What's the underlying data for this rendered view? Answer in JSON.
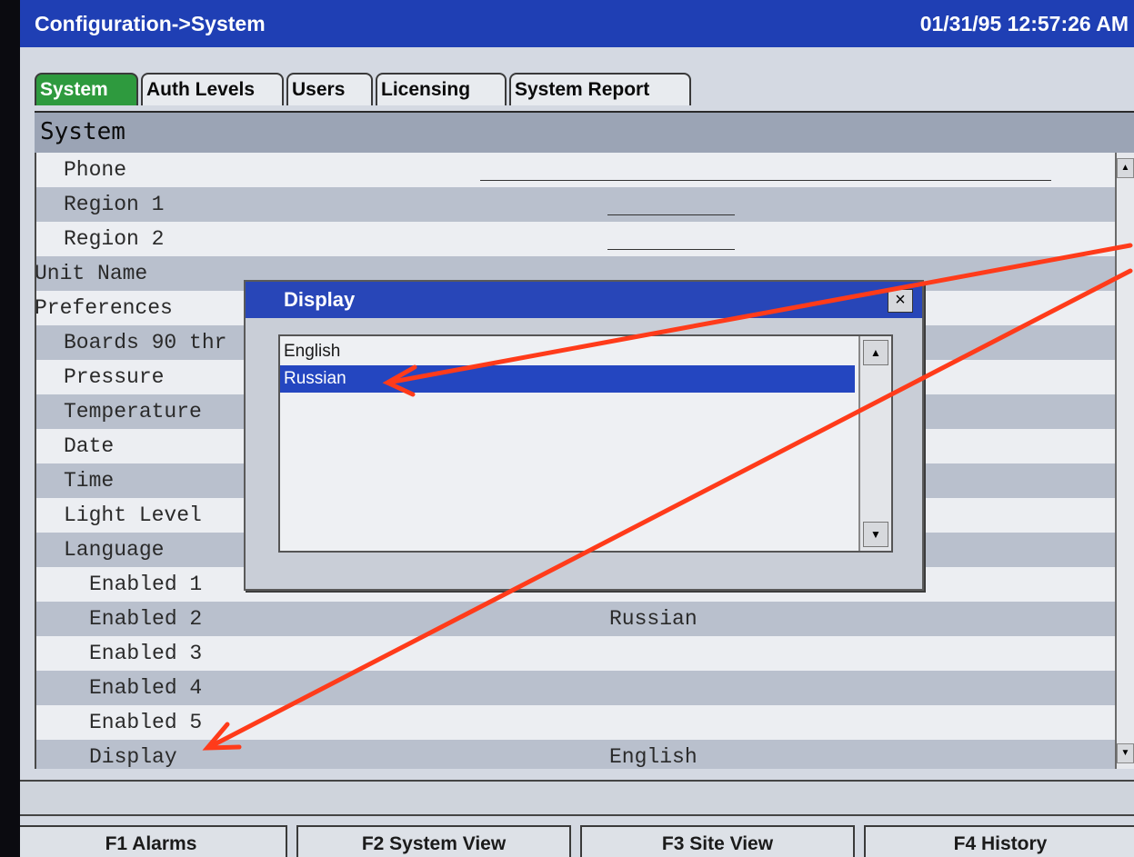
{
  "header": {
    "title": "Configuration->System",
    "datetime": "01/31/95 12:57:26 AM"
  },
  "tabs": [
    {
      "label": "System",
      "active": true
    },
    {
      "label": "Auth Levels",
      "active": false
    },
    {
      "label": "Users",
      "active": false
    },
    {
      "label": "Licensing",
      "active": false
    },
    {
      "label": "System Report",
      "active": false
    }
  ],
  "section": {
    "title": "System"
  },
  "rows": [
    {
      "label": "Phone",
      "value": ""
    },
    {
      "label": "Region 1",
      "value": ""
    },
    {
      "label": "Region 2",
      "value": ""
    },
    {
      "label": "Unit Name",
      "value": ""
    },
    {
      "label": "Preferences",
      "value": ""
    },
    {
      "label": "Boards 90 thr",
      "value": ""
    },
    {
      "label": "Pressure",
      "value": ""
    },
    {
      "label": "Temperature",
      "value": ""
    },
    {
      "label": "Date",
      "value": ""
    },
    {
      "label": "Time",
      "value": ""
    },
    {
      "label": "Light Level",
      "value": ""
    },
    {
      "label": "Language",
      "value": ""
    },
    {
      "label": "Enabled 1",
      "value": ""
    },
    {
      "label": "Enabled 2",
      "value": "Russian"
    },
    {
      "label": "Enabled 3",
      "value": ""
    },
    {
      "label": "Enabled 4",
      "value": ""
    },
    {
      "label": "Enabled 5",
      "value": ""
    },
    {
      "label": "Display",
      "value": "English"
    }
  ],
  "dialog": {
    "title": "Display",
    "close_label": "×",
    "options": [
      {
        "label": "English",
        "selected": false
      },
      {
        "label": "Russian",
        "selected": true
      }
    ],
    "scroll_up": "▲",
    "scroll_down": "▼"
  },
  "function_keys": [
    {
      "label": "F1 Alarms"
    },
    {
      "label": "F2 System View"
    },
    {
      "label": "F3 Site View"
    },
    {
      "label": "F4 History"
    }
  ],
  "colors": {
    "title_bar": "#1f3fb4",
    "active_tab": "#2e9a3e",
    "selection": "#2446c0",
    "annotation_arrow": "#ff3b1a"
  }
}
